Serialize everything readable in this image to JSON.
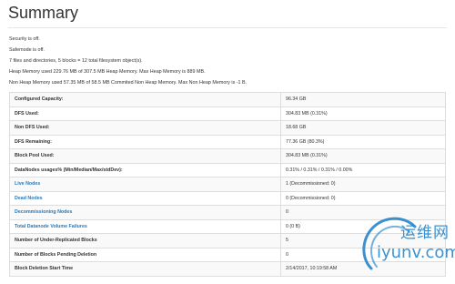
{
  "page": {
    "title": "Summary"
  },
  "info": {
    "security": "Security is off.",
    "safemode": "Safemode is off.",
    "files": "7 files and directories, 5 blocks = 12 total filesystem object(s).",
    "heap": "Heap Memory used 229.76 MB of 307.5 MB Heap Memory. Max Heap Memory is 889 MB.",
    "nonheap": "Non Heap Memory used 57.35 MB of 58.5 MB Commited Non Heap Memory. Max Non Heap Memory is -1 B."
  },
  "table": {
    "rows": [
      {
        "label": "Configured Capacity:",
        "value": "96.34 GB"
      },
      {
        "label": "DFS Used:",
        "value": "304.83 MB (0.31%)"
      },
      {
        "label": "Non DFS Used:",
        "value": "18.68 GB"
      },
      {
        "label": "DFS Remaining:",
        "value": "77.36 GB (80.3%)"
      },
      {
        "label": "Block Pool Used:",
        "value": "304.83 MB (0.31%)"
      },
      {
        "label": "DataNodes usages% (Min/Median/Max/stdDev):",
        "value": "0.31% / 0.31% / 0.31% / 0.00%"
      },
      {
        "label": "Live Nodes",
        "value": "1 (Decommissioned: 0)"
      },
      {
        "label": "Dead Nodes",
        "value": "0 (Decommissioned: 0)"
      },
      {
        "label": "Decommissioning Nodes",
        "value": "0"
      },
      {
        "label": "Total Datanode Volume Failures",
        "value": "0 (0 B)"
      },
      {
        "label": "Number of Under-Replicated Blocks",
        "value": "5"
      },
      {
        "label": "Number of Blocks Pending Deletion",
        "value": "0"
      },
      {
        "label": "Block Deletion Start Time",
        "value": "2/14/2017, 10:19:58 AM"
      }
    ]
  },
  "watermark": {
    "text_cn": "运维网",
    "text_en": "iyunv.com"
  },
  "colors": {
    "link": "#2a7ab8",
    "text": "#333333",
    "watermark": "#1a7fc6"
  }
}
